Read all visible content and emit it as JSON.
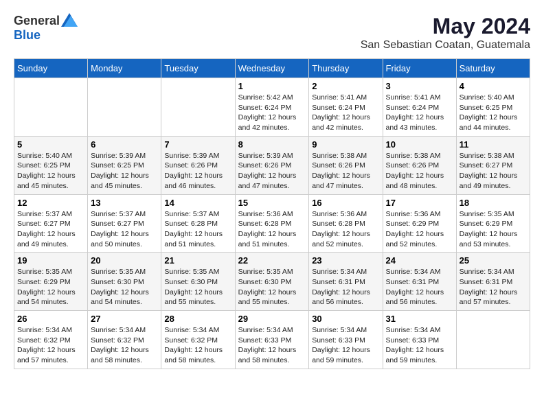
{
  "header": {
    "logo_general": "General",
    "logo_blue": "Blue",
    "month_year": "May 2024",
    "location": "San Sebastian Coatan, Guatemala"
  },
  "days_of_week": [
    "Sunday",
    "Monday",
    "Tuesday",
    "Wednesday",
    "Thursday",
    "Friday",
    "Saturday"
  ],
  "weeks": [
    [
      {
        "day": "",
        "info": ""
      },
      {
        "day": "",
        "info": ""
      },
      {
        "day": "",
        "info": ""
      },
      {
        "day": "1",
        "info": "Sunrise: 5:42 AM\nSunset: 6:24 PM\nDaylight: 12 hours\nand 42 minutes."
      },
      {
        "day": "2",
        "info": "Sunrise: 5:41 AM\nSunset: 6:24 PM\nDaylight: 12 hours\nand 42 minutes."
      },
      {
        "day": "3",
        "info": "Sunrise: 5:41 AM\nSunset: 6:24 PM\nDaylight: 12 hours\nand 43 minutes."
      },
      {
        "day": "4",
        "info": "Sunrise: 5:40 AM\nSunset: 6:25 PM\nDaylight: 12 hours\nand 44 minutes."
      }
    ],
    [
      {
        "day": "5",
        "info": "Sunrise: 5:40 AM\nSunset: 6:25 PM\nDaylight: 12 hours\nand 45 minutes."
      },
      {
        "day": "6",
        "info": "Sunrise: 5:39 AM\nSunset: 6:25 PM\nDaylight: 12 hours\nand 45 minutes."
      },
      {
        "day": "7",
        "info": "Sunrise: 5:39 AM\nSunset: 6:26 PM\nDaylight: 12 hours\nand 46 minutes."
      },
      {
        "day": "8",
        "info": "Sunrise: 5:39 AM\nSunset: 6:26 PM\nDaylight: 12 hours\nand 47 minutes."
      },
      {
        "day": "9",
        "info": "Sunrise: 5:38 AM\nSunset: 6:26 PM\nDaylight: 12 hours\nand 47 minutes."
      },
      {
        "day": "10",
        "info": "Sunrise: 5:38 AM\nSunset: 6:26 PM\nDaylight: 12 hours\nand 48 minutes."
      },
      {
        "day": "11",
        "info": "Sunrise: 5:38 AM\nSunset: 6:27 PM\nDaylight: 12 hours\nand 49 minutes."
      }
    ],
    [
      {
        "day": "12",
        "info": "Sunrise: 5:37 AM\nSunset: 6:27 PM\nDaylight: 12 hours\nand 49 minutes."
      },
      {
        "day": "13",
        "info": "Sunrise: 5:37 AM\nSunset: 6:27 PM\nDaylight: 12 hours\nand 50 minutes."
      },
      {
        "day": "14",
        "info": "Sunrise: 5:37 AM\nSunset: 6:28 PM\nDaylight: 12 hours\nand 51 minutes."
      },
      {
        "day": "15",
        "info": "Sunrise: 5:36 AM\nSunset: 6:28 PM\nDaylight: 12 hours\nand 51 minutes."
      },
      {
        "day": "16",
        "info": "Sunrise: 5:36 AM\nSunset: 6:28 PM\nDaylight: 12 hours\nand 52 minutes."
      },
      {
        "day": "17",
        "info": "Sunrise: 5:36 AM\nSunset: 6:29 PM\nDaylight: 12 hours\nand 52 minutes."
      },
      {
        "day": "18",
        "info": "Sunrise: 5:35 AM\nSunset: 6:29 PM\nDaylight: 12 hours\nand 53 minutes."
      }
    ],
    [
      {
        "day": "19",
        "info": "Sunrise: 5:35 AM\nSunset: 6:29 PM\nDaylight: 12 hours\nand 54 minutes."
      },
      {
        "day": "20",
        "info": "Sunrise: 5:35 AM\nSunset: 6:30 PM\nDaylight: 12 hours\nand 54 minutes."
      },
      {
        "day": "21",
        "info": "Sunrise: 5:35 AM\nSunset: 6:30 PM\nDaylight: 12 hours\nand 55 minutes."
      },
      {
        "day": "22",
        "info": "Sunrise: 5:35 AM\nSunset: 6:30 PM\nDaylight: 12 hours\nand 55 minutes."
      },
      {
        "day": "23",
        "info": "Sunrise: 5:34 AM\nSunset: 6:31 PM\nDaylight: 12 hours\nand 56 minutes."
      },
      {
        "day": "24",
        "info": "Sunrise: 5:34 AM\nSunset: 6:31 PM\nDaylight: 12 hours\nand 56 minutes."
      },
      {
        "day": "25",
        "info": "Sunrise: 5:34 AM\nSunset: 6:31 PM\nDaylight: 12 hours\nand 57 minutes."
      }
    ],
    [
      {
        "day": "26",
        "info": "Sunrise: 5:34 AM\nSunset: 6:32 PM\nDaylight: 12 hours\nand 57 minutes."
      },
      {
        "day": "27",
        "info": "Sunrise: 5:34 AM\nSunset: 6:32 PM\nDaylight: 12 hours\nand 58 minutes."
      },
      {
        "day": "28",
        "info": "Sunrise: 5:34 AM\nSunset: 6:32 PM\nDaylight: 12 hours\nand 58 minutes."
      },
      {
        "day": "29",
        "info": "Sunrise: 5:34 AM\nSunset: 6:33 PM\nDaylight: 12 hours\nand 58 minutes."
      },
      {
        "day": "30",
        "info": "Sunrise: 5:34 AM\nSunset: 6:33 PM\nDaylight: 12 hours\nand 59 minutes."
      },
      {
        "day": "31",
        "info": "Sunrise: 5:34 AM\nSunset: 6:33 PM\nDaylight: 12 hours\nand 59 minutes."
      },
      {
        "day": "",
        "info": ""
      }
    ]
  ]
}
